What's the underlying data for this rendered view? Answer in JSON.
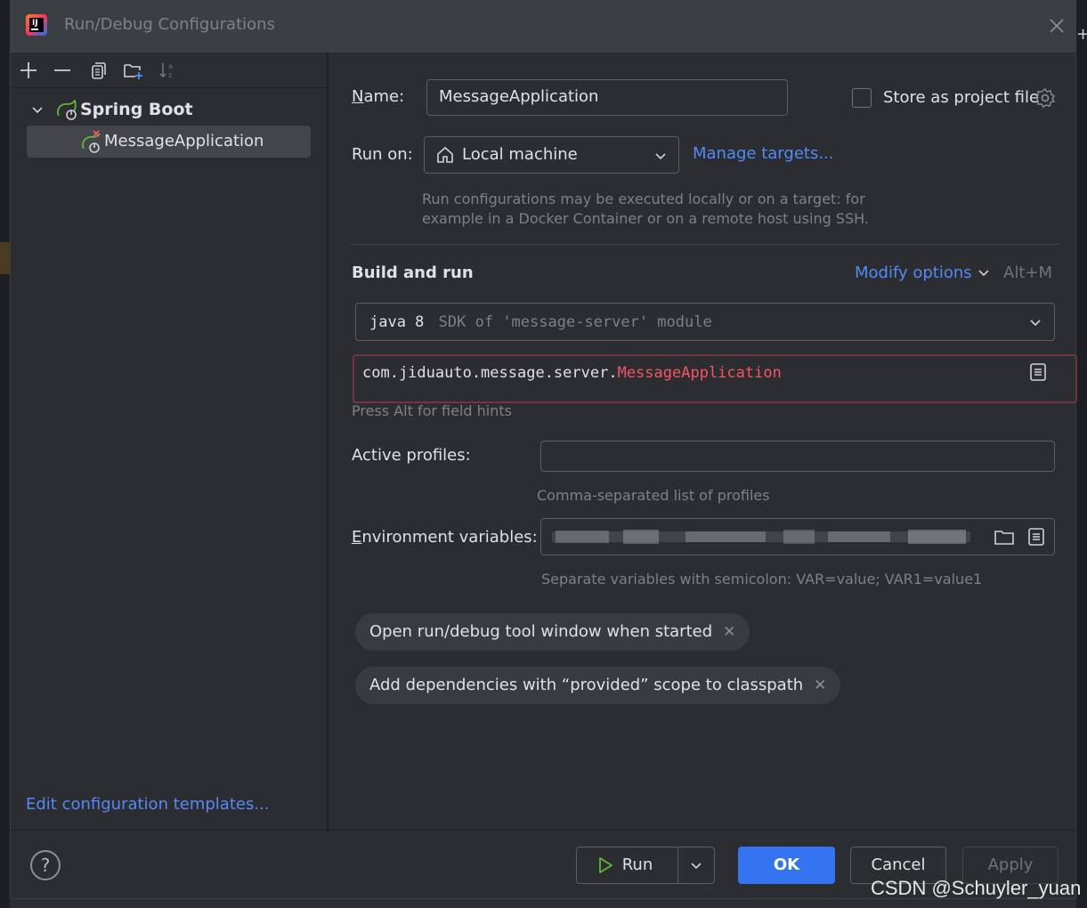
{
  "window": {
    "title": "Run/Debug Configurations"
  },
  "toolbar": {
    "icons": [
      "add-icon",
      "remove-icon",
      "copy-icon",
      "new-folder-icon",
      "sort-icon"
    ]
  },
  "tree": {
    "group_label": "Spring Boot",
    "items": [
      {
        "label": "MessageApplication"
      }
    ]
  },
  "left_footer": {
    "edit_templates_link": "Edit configuration templates..."
  },
  "form": {
    "name_label": "Name:",
    "name_value": "MessageApplication",
    "store_as_project_file_label": "Store as project file",
    "run_on_label": "Run on:",
    "run_on_value": "Local machine",
    "manage_targets_link": "Manage targets...",
    "run_on_hint_line1": "Run configurations may be executed locally or on a target: for",
    "run_on_hint_line2": "example in a Docker Container or on a remote host using SSH.",
    "build_run_title": "Build and run",
    "modify_options_link": "Modify options",
    "modify_options_shortcut": "Alt+M",
    "sdk_java": "java 8",
    "sdk_detail": "SDK of 'message-server' module",
    "main_class_package": "com.jiduauto.message.server.",
    "main_class_name": "MessageApplication",
    "field_hints_text": "Press Alt for field hints",
    "active_profiles_label": "Active profiles:",
    "active_profiles_value": "",
    "active_profiles_hint": "Comma-separated list of profiles",
    "env_vars_label": "Environment variables:",
    "env_vars_hint": "Separate variables with semicolon: VAR=value; VAR1=value1",
    "chips": [
      {
        "label": "Open run/debug tool window when started"
      },
      {
        "label": "Add dependencies with “provided” scope to classpath"
      }
    ]
  },
  "buttons": {
    "run_label": "Run",
    "ok_label": "OK",
    "cancel_label": "Cancel",
    "apply_label": "Apply",
    "help_label": "?"
  },
  "watermark": "CSDN @Schuyler_yuan",
  "colors": {
    "link": "#548af7",
    "primary_button": "#3574f0",
    "error_border": "#73343a",
    "error_text": "#f75464",
    "spring_green": "#5fb832"
  }
}
